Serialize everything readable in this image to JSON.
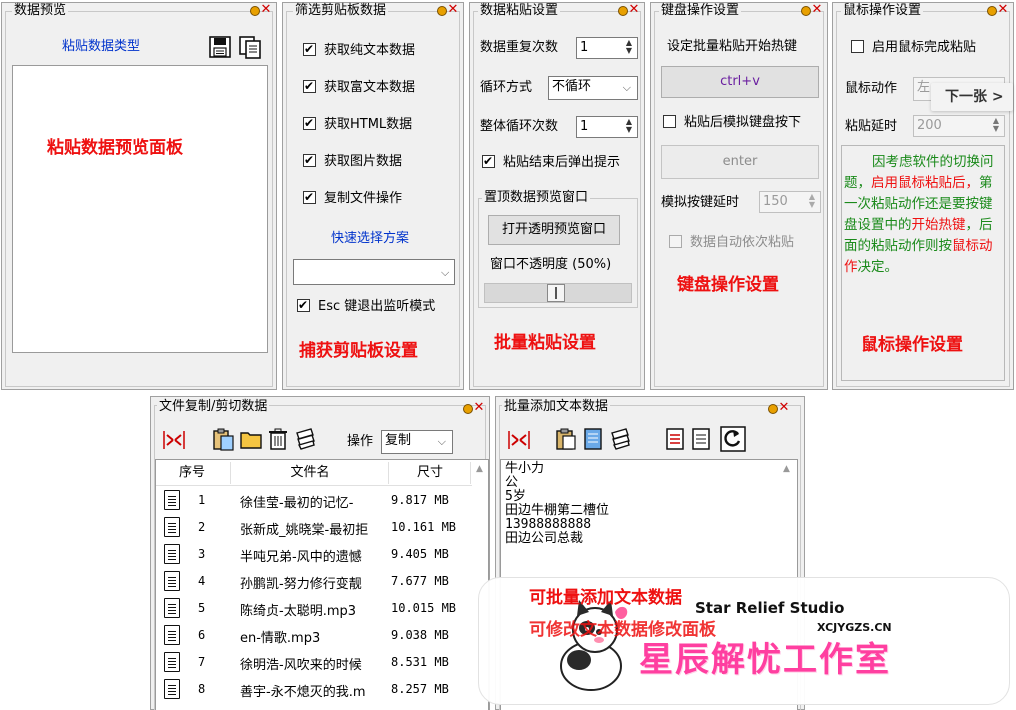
{
  "colors": {
    "accent_red": "#ee1111",
    "link_blue": "#0033cc",
    "panel_bg": "#f0f0f0",
    "note_green": "#1a8a1a",
    "note_bg": "#eaf6ea"
  },
  "preview": {
    "title": "数据预览",
    "type_link": "粘贴数据类型",
    "panel_label": "粘贴数据预览面板"
  },
  "filter": {
    "title": "筛选剪贴板数据",
    "options": [
      {
        "label": "获取纯文本数据",
        "checked": true
      },
      {
        "label": "获取富文本数据",
        "checked": true
      },
      {
        "label": "获取HTML数据",
        "checked": true
      },
      {
        "label": "获取图片数据",
        "checked": true
      },
      {
        "label": "复制文件操作",
        "checked": true
      }
    ],
    "scheme_link": "快速选择方案",
    "scheme_value": "",
    "esc_label": "Esc 键退出监听模式",
    "esc_checked": true,
    "section_label": "捕获剪贴板设置"
  },
  "paste": {
    "title": "数据粘贴设置",
    "repeat_label": "数据重复次数",
    "repeat_value": "1",
    "loop_label": "循环方式",
    "loop_value": "不循环",
    "total_label": "整体循环次数",
    "total_value": "1",
    "popup_label": "粘贴结束后弹出提示",
    "popup_checked": true,
    "pin_group_title": "置顶数据预览窗口",
    "open_button": "打开透明预览窗口",
    "opacity_label": "窗口不透明度 (50%)",
    "opacity_value": 0.5,
    "section_label": "批量粘贴设置"
  },
  "keyboard": {
    "title": "键盘操作设置",
    "hotkey_title": "设定批量粘贴开始热键",
    "hotkey_value": "ctrl+v",
    "simulate_label": "粘贴后模拟键盘按下",
    "simulate_checked": false,
    "key_value": "enter",
    "delay_label": "模拟按键延时",
    "delay_value": "150",
    "auto_label": "数据自动依次粘贴",
    "auto_checked": false,
    "section_label": "键盘操作设置"
  },
  "mouse": {
    "title": "鼠标操作设置",
    "enable_label": "启用鼠标完成粘贴",
    "enable_checked": false,
    "action_label": "鼠标动作",
    "action_value": "左",
    "delay_label": "粘贴延时",
    "delay_value": "200",
    "next_tooltip": "下一张 >",
    "note_parts": [
      {
        "text": "因考虑软件的切换问题，",
        "color": "green"
      },
      {
        "text": "启用鼠标粘贴后，",
        "color": "red"
      },
      {
        "text": "第一次粘贴动作还是要按键盘设置中的",
        "color": "green"
      },
      {
        "text": "开始热键",
        "color": "red"
      },
      {
        "text": "，后面的粘贴动作则按",
        "color": "green"
      },
      {
        "text": "鼠标动作",
        "color": "red"
      },
      {
        "text": "决定。",
        "color": "green"
      }
    ],
    "section_label": "鼠标操作设置"
  },
  "files": {
    "title": "文件复制/剪切数据",
    "op_label": "操作",
    "op_value": "复制",
    "columns": [
      "序号",
      "文件名",
      "尺寸"
    ],
    "rows": [
      {
        "num": "1",
        "name": "徐佳莹-最初的记忆-",
        "size": "9.817 MB"
      },
      {
        "num": "2",
        "name": "张新成_姚晓棠-最初拒",
        "size": "10.161 MB"
      },
      {
        "num": "3",
        "name": "半吨兄弟-风中的遗憾",
        "size": "9.405 MB"
      },
      {
        "num": "4",
        "name": "孙鹏凯-努力修行变靓",
        "size": "7.677 MB"
      },
      {
        "num": "5",
        "name": "陈绮贞-太聪明.mp3",
        "size": "10.015 MB"
      },
      {
        "num": "6",
        "name": "en-情歌.mp3",
        "size": "9.038 MB"
      },
      {
        "num": "7",
        "name": "徐明浩-风吹来的时候",
        "size": "8.531 MB"
      },
      {
        "num": "8",
        "name": "善宇-永不熄灭的我.m",
        "size": "8.257 MB"
      }
    ]
  },
  "batch": {
    "title": "批量添加文本数据",
    "lines": [
      "牛小力",
      "公",
      "5岁",
      "田边牛棚第二槽位",
      "13988888888",
      "田边公司总裁"
    ],
    "caption1": "可批量添加文本数据",
    "caption2": "可修改文本数据修改面板",
    "studio_en": "Star Relief Studio",
    "studio_url": "XCJYGZS.CN",
    "studio_cn": "星辰解忧工作室"
  }
}
